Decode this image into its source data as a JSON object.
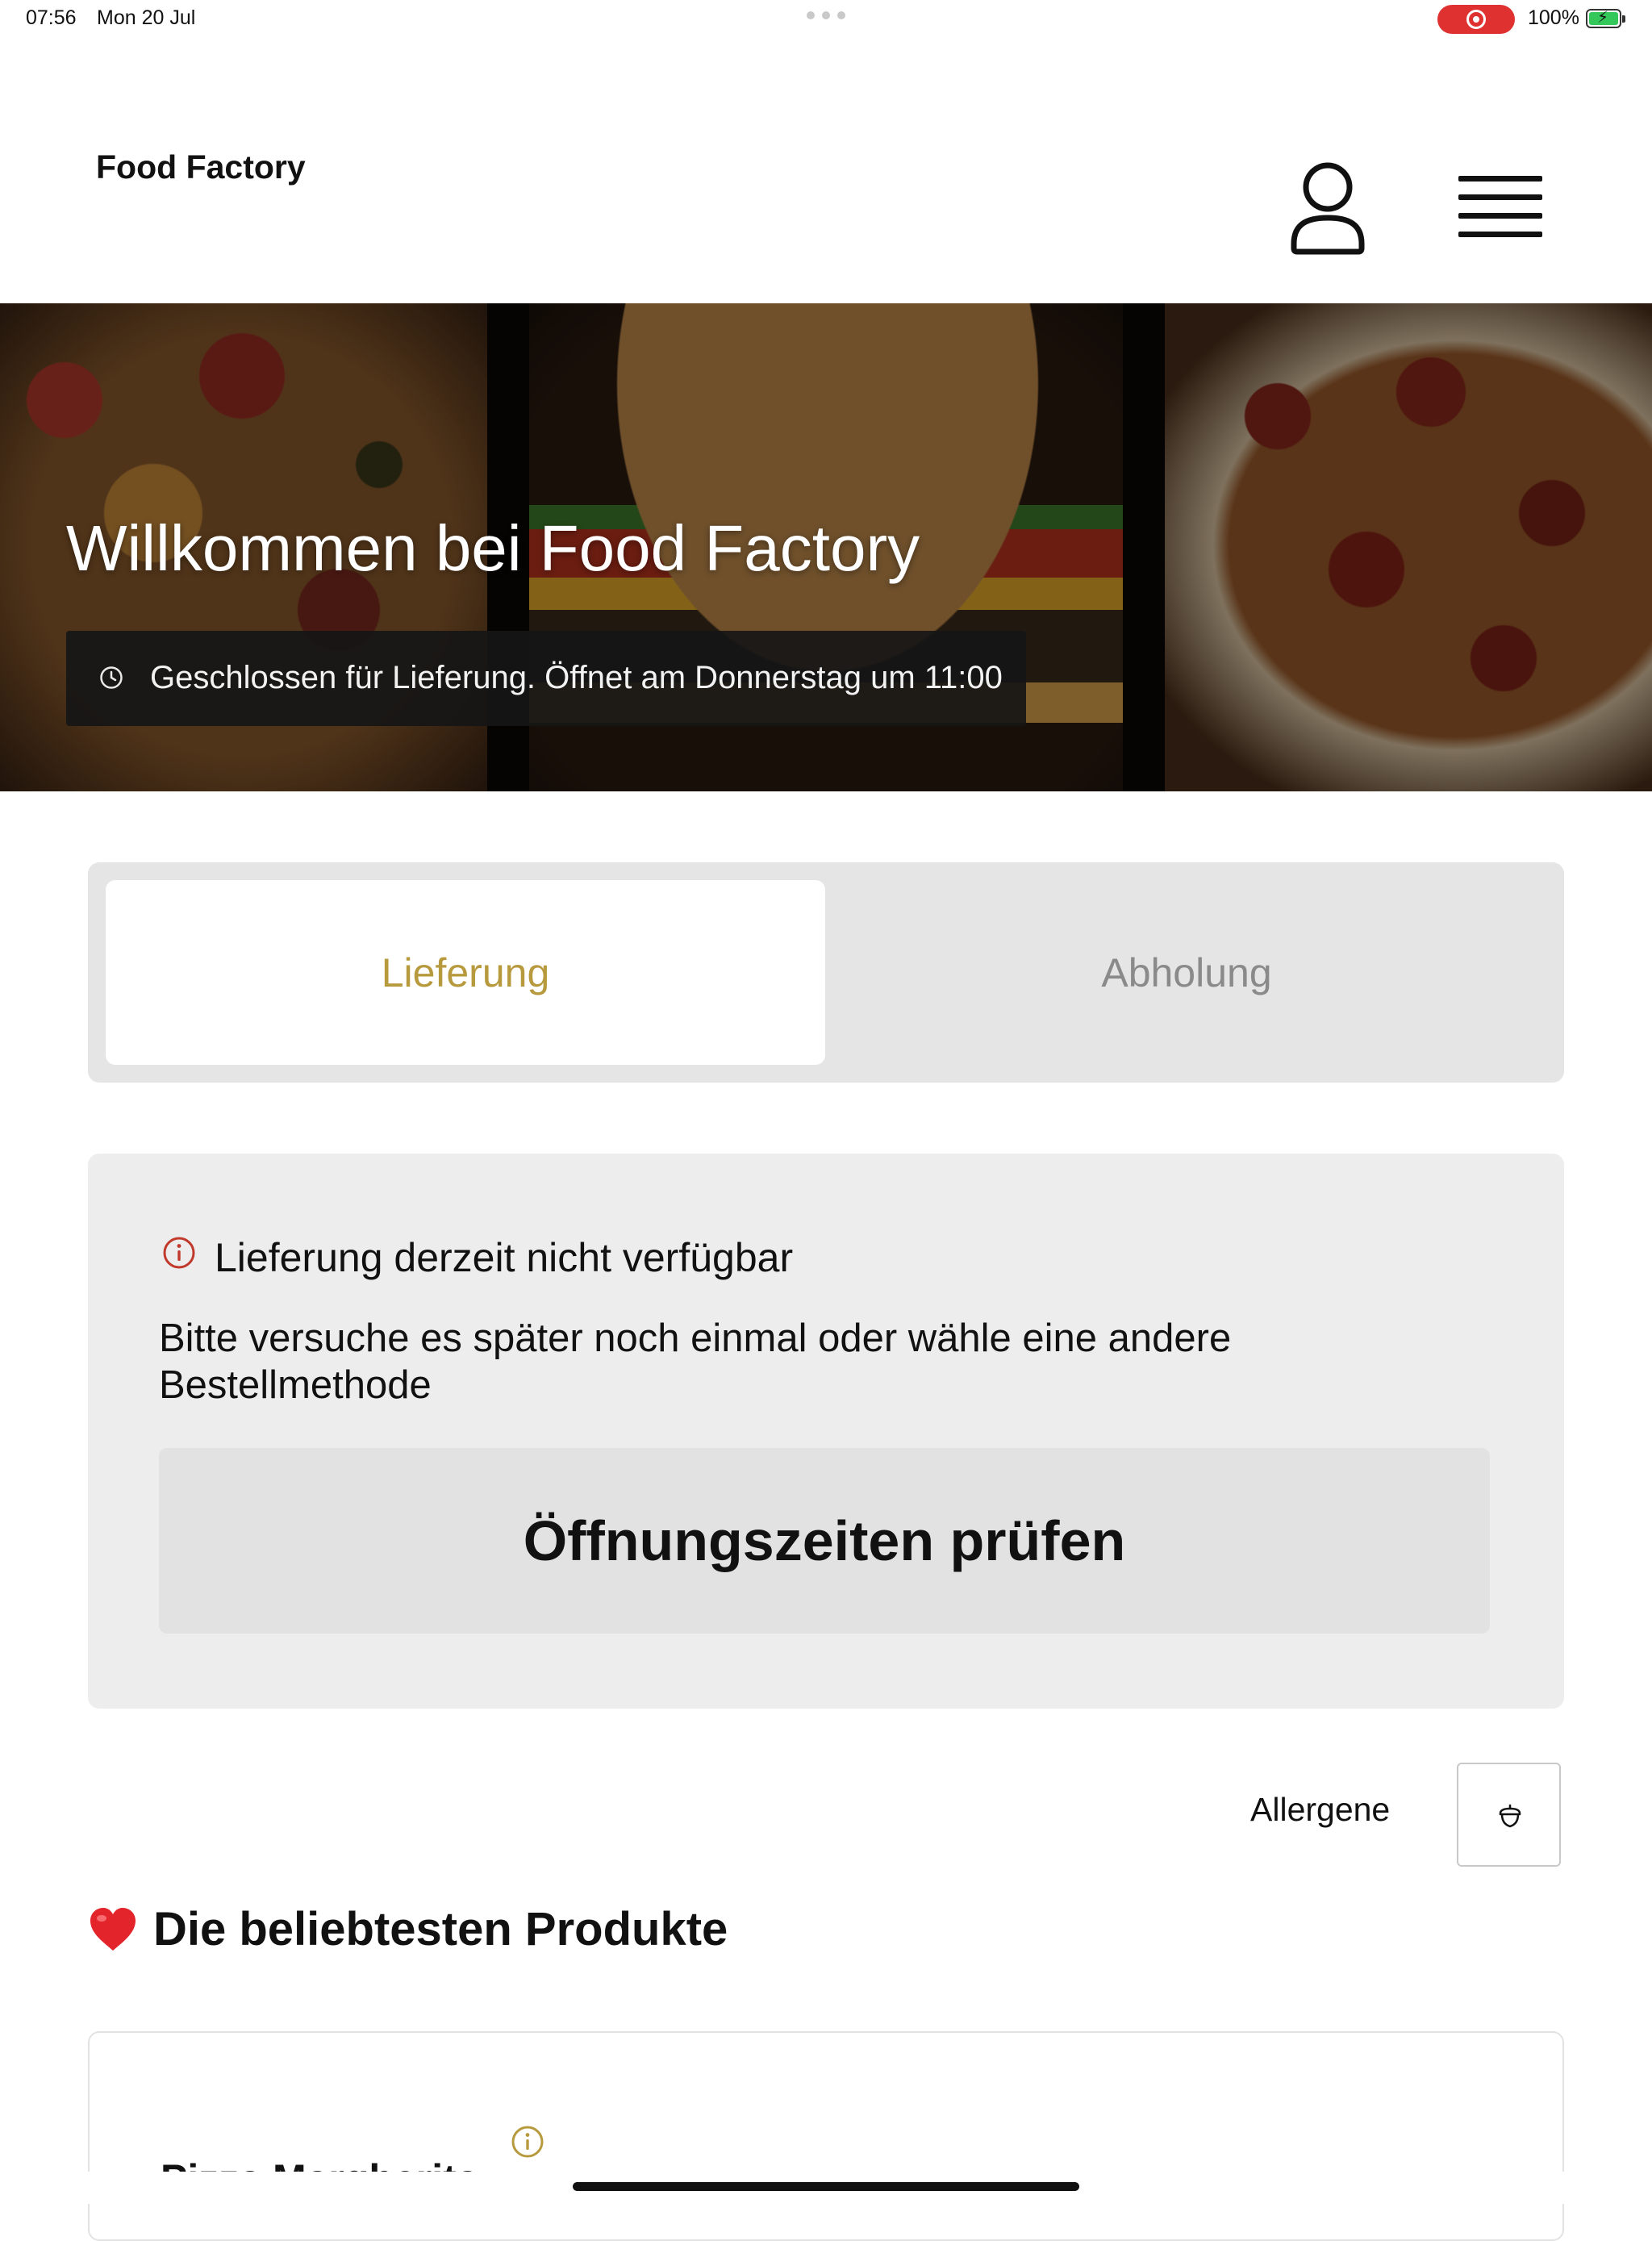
{
  "status_bar": {
    "time": "07:56",
    "date": "Mon 20 Jul",
    "battery": "100%",
    "record_color": "#e03131"
  },
  "header": {
    "brand": "Food Factory",
    "icons": [
      "user-icon",
      "hamburger-menu-icon"
    ]
  },
  "hero": {
    "title": "Willkommen bei Food Factory",
    "status_text": "Geschlossen für Lieferung. Öffnet am Donnerstag um 11:00",
    "status_icon": "clock-icon"
  },
  "order_method": {
    "tabs": [
      {
        "label": "Lieferung",
        "selected": true
      },
      {
        "label": "Abholung",
        "selected": false
      }
    ],
    "accent_color": "#b89a3e"
  },
  "alert": {
    "icon": "info-icon",
    "icon_color": "#c0392b",
    "title": "Lieferung derzeit nicht verfügbar",
    "body": "Bitte versuche es später noch einmal oder wähle eine andere Bestellmethode",
    "button_label": "Öffnungszeiten prüfen"
  },
  "allergens": {
    "label": "Allergene",
    "icon": "acorn-icon"
  },
  "popular": {
    "heading": "Die beliebtesten Produkte",
    "heading_icon": "heart-icon",
    "products": [
      {
        "name": "Pizza Margherita",
        "info_icon": "info-icon",
        "info_color": "#b89a3e"
      }
    ]
  }
}
